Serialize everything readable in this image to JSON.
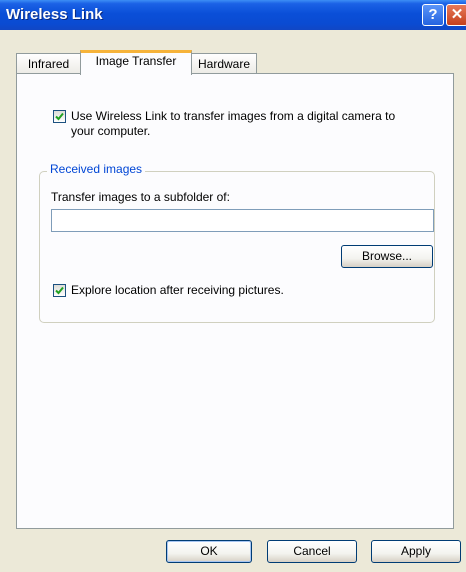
{
  "window": {
    "title": "Wireless Link",
    "help_glyph": "?",
    "close_glyph": "✕"
  },
  "tabs": [
    {
      "label": "Infrared",
      "active": false
    },
    {
      "label": "Image Transfer",
      "active": true
    },
    {
      "label": "Hardware",
      "active": false
    }
  ],
  "options": {
    "use_wireless_link_label_line1": "Use Wireless Link to transfer images from a digital camera to",
    "use_wireless_link_label_line2": "your computer.",
    "use_wireless_link_checked": true
  },
  "received_images": {
    "legend": "Received images",
    "folder_label": "Transfer images to a subfolder of:",
    "folder_value": "",
    "browse_label": "Browse...",
    "explore_label": "Explore location after receiving pictures.",
    "explore_checked": true
  },
  "footer": {
    "ok_label": "OK",
    "cancel_label": "Cancel",
    "apply_label": "Apply"
  },
  "icons": {
    "help": "help-icon",
    "close": "close-icon",
    "check": "checkmark-icon"
  },
  "colors": {
    "titlebar": "#0a4fd8",
    "legend_text": "#0046d5",
    "active_tab_accent": "#f6b33a"
  }
}
